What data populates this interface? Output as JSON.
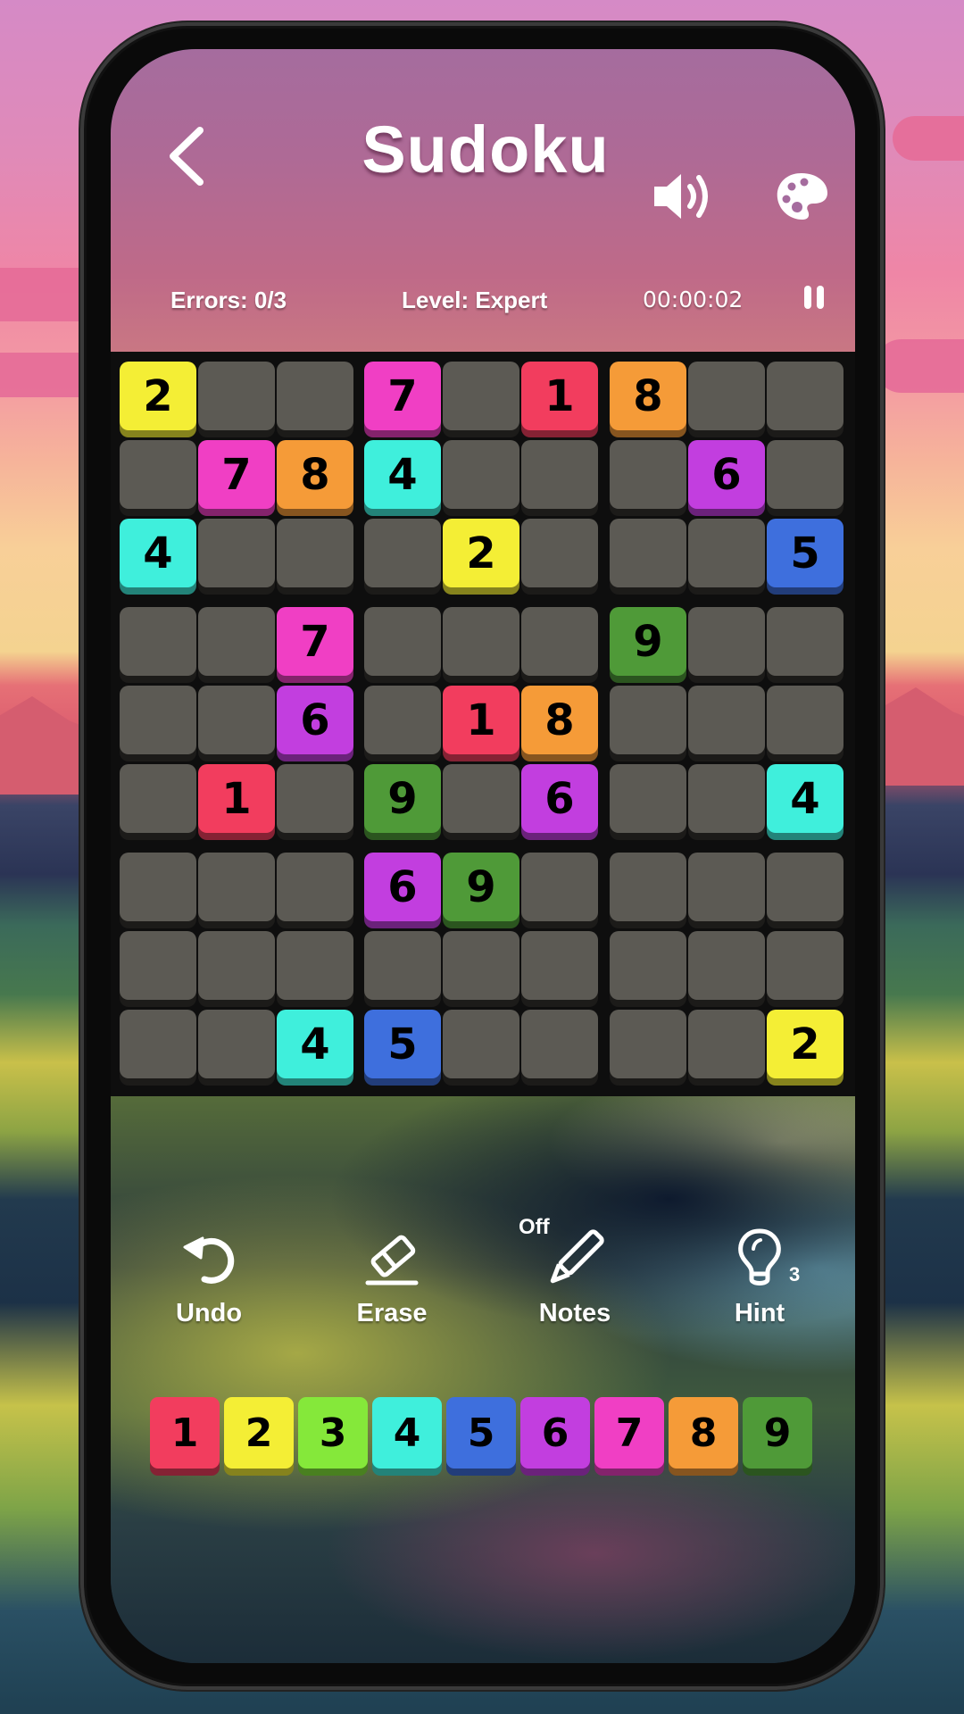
{
  "header": {
    "title": "Sudoku",
    "back_icon": "chevron-left-icon",
    "sound_icon": "speaker-icon",
    "theme_icon": "palette-icon"
  },
  "stats": {
    "errors": "Errors: 0/3",
    "level": "Level: Expert",
    "timer": "00:00:02",
    "pause_icon": "pause-icon"
  },
  "colors": {
    "1": "#f23d5e",
    "2": "#f4ee35",
    "3": "#85e83a",
    "4": "#3fefdc",
    "5": "#3e6fdd",
    "6": "#c23edf",
    "7": "#f03fc4",
    "8": "#f59b38",
    "9": "#4f9a38",
    "empty": "#5c5a54"
  },
  "board": [
    [
      2,
      0,
      0,
      7,
      0,
      1,
      8,
      0,
      0
    ],
    [
      0,
      7,
      8,
      4,
      0,
      0,
      0,
      6,
      0
    ],
    [
      4,
      0,
      0,
      0,
      2,
      0,
      0,
      0,
      5
    ],
    [
      0,
      0,
      7,
      0,
      0,
      0,
      9,
      0,
      0
    ],
    [
      0,
      0,
      6,
      0,
      1,
      8,
      0,
      0,
      0
    ],
    [
      0,
      1,
      0,
      9,
      0,
      6,
      0,
      0,
      4
    ],
    [
      0,
      0,
      0,
      6,
      9,
      0,
      0,
      0,
      0
    ],
    [
      0,
      0,
      0,
      0,
      0,
      0,
      0,
      0,
      0
    ],
    [
      0,
      0,
      4,
      5,
      0,
      0,
      0,
      0,
      2
    ]
  ],
  "controls": {
    "undo": {
      "label": "Undo",
      "icon": "undo-icon"
    },
    "erase": {
      "label": "Erase",
      "icon": "eraser-icon"
    },
    "notes": {
      "label": "Notes",
      "icon": "pencil-icon",
      "state": "Off"
    },
    "hint": {
      "label": "Hint",
      "icon": "lightbulb-icon",
      "count": "3"
    }
  },
  "number_pad": [
    "1",
    "2",
    "3",
    "4",
    "5",
    "6",
    "7",
    "8",
    "9"
  ]
}
